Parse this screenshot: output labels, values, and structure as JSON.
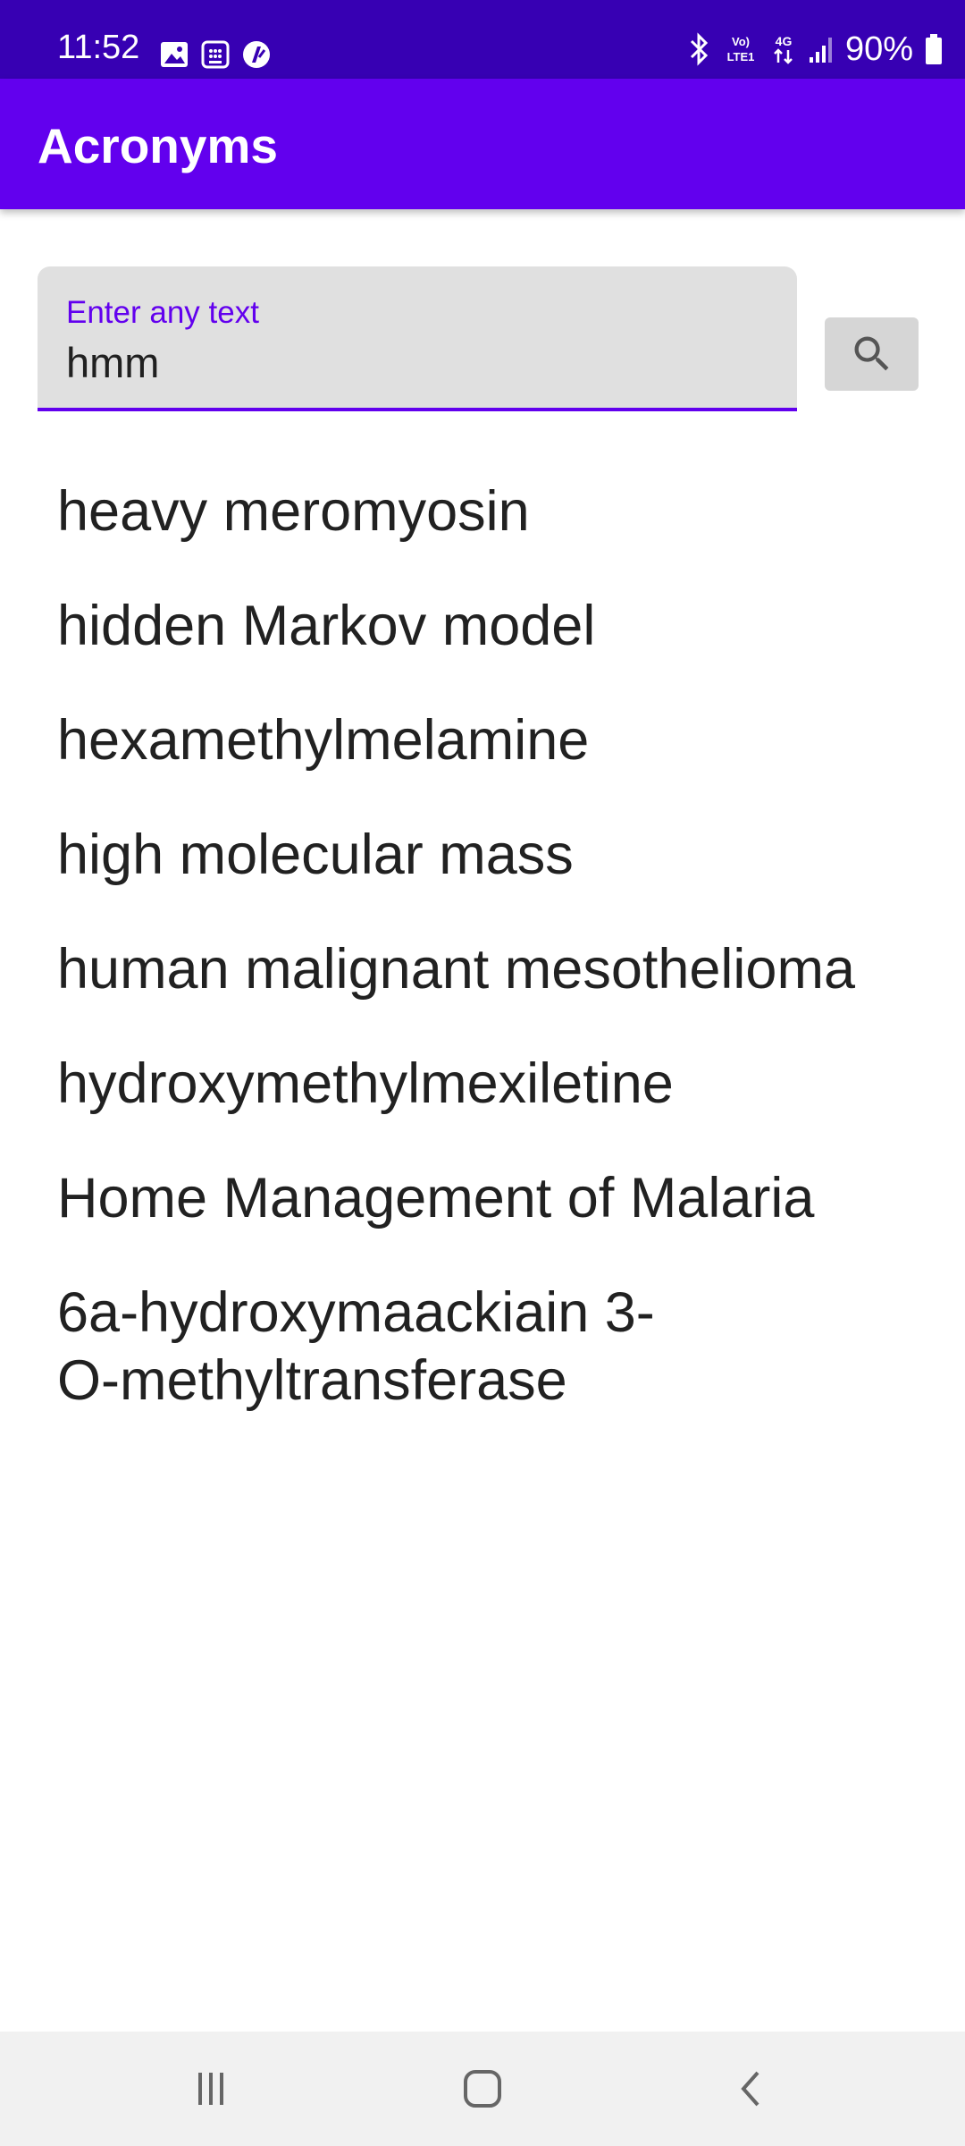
{
  "status_bar": {
    "time": "11:52",
    "battery_percent": "90%",
    "network_label": "4G",
    "volte_label": "Vo) LTE1",
    "battery_level": 0.9,
    "left_icons": [
      "image-icon",
      "calendar-icon",
      "app-notification-icon"
    ],
    "right_icons": [
      "bluetooth-icon",
      "volte-icon",
      "4g-data-icon",
      "signal-icon",
      "battery-icon"
    ]
  },
  "app_bar": {
    "title": "Acronyms"
  },
  "search": {
    "label": "Enter any text",
    "value": "hmm",
    "button_icon": "search-icon"
  },
  "results": [
    "heavy meromyosin",
    "hidden Markov model",
    "hexamethylmelamine",
    "high molecular mass",
    "human malignant mesothelioma",
    "hydroxymethylmexiletine",
    "Home Management of Malaria",
    "6a-hydroxymaackiain 3-O-methyltransferase"
  ],
  "nav_bar": {
    "buttons": [
      "recent-apps-icon",
      "home-icon",
      "back-icon"
    ]
  },
  "colors": {
    "status_bar": "#3700b3",
    "app_bar": "#6200ee",
    "accent": "#6200ee",
    "field_bg": "#e0e0e0",
    "text": "#212121"
  }
}
